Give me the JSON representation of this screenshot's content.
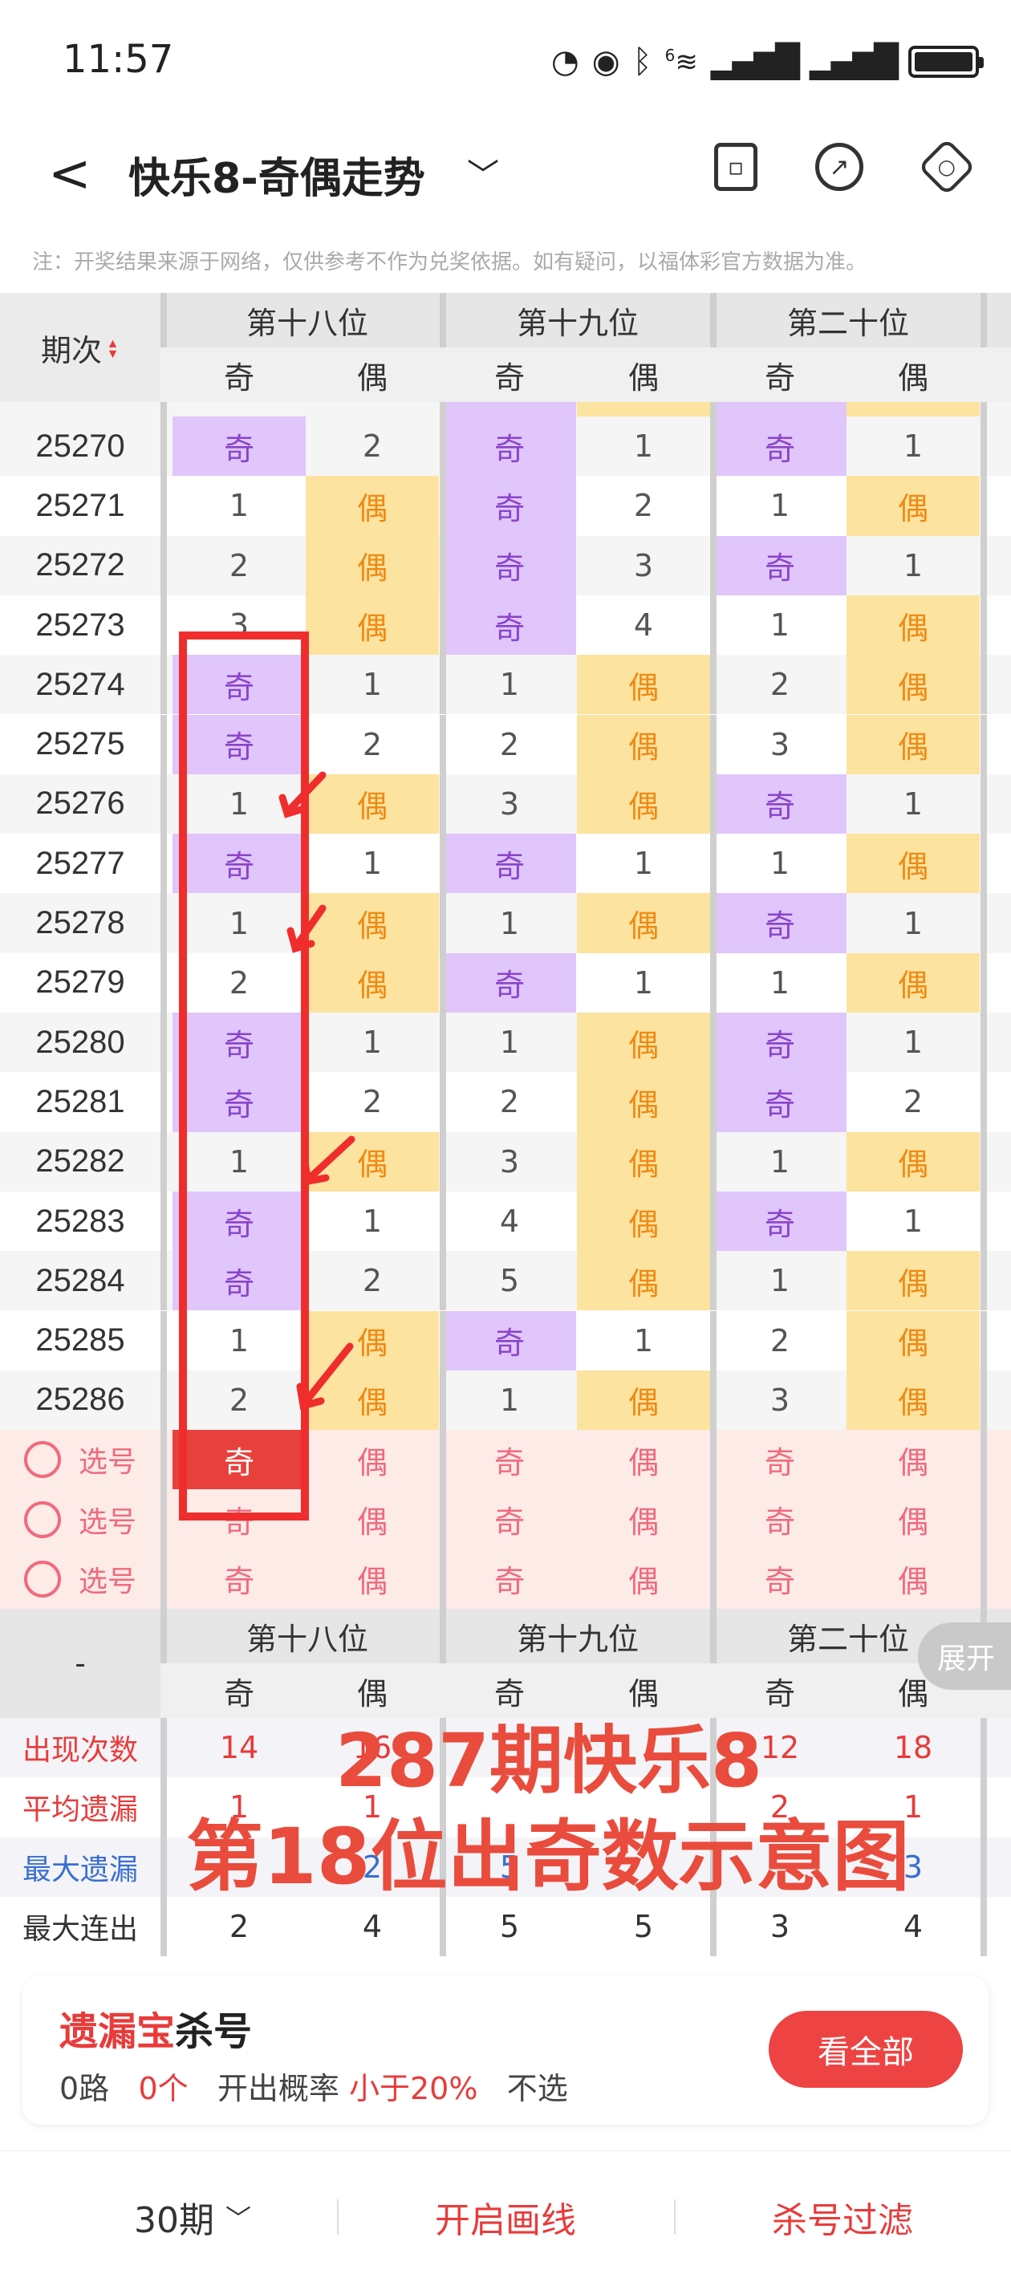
{
  "status": {
    "time": "11:57",
    "net_label": "6"
  },
  "header": {
    "title": "快乐8-奇偶走势",
    "back_glyph": "<",
    "dropdown_glyph": "﹀"
  },
  "notice": "注：开奖结果来源于网络，仅供参考不作为兑奖依据。如有疑问，以福体彩官方数据为准。",
  "table": {
    "issue_header": "期次",
    "sort_glyph": "▲▼",
    "groups": [
      "第十八位",
      "第十九位",
      "第二十位"
    ],
    "sub": [
      "奇",
      "偶"
    ],
    "rows": [
      {
        "issue": "25270",
        "cells": [
          "奇",
          "2",
          "奇",
          "1",
          "奇",
          "1"
        ],
        "hits": [
          "odd",
          "",
          "odd",
          "",
          "odd",
          ""
        ]
      },
      {
        "issue": "25271",
        "cells": [
          "1",
          "偶",
          "奇",
          "2",
          "1",
          "偶"
        ],
        "hits": [
          "",
          "even",
          "odd",
          "",
          "",
          "even"
        ]
      },
      {
        "issue": "25272",
        "cells": [
          "2",
          "偶",
          "奇",
          "3",
          "奇",
          "1"
        ],
        "hits": [
          "",
          "even",
          "odd",
          "",
          "odd",
          ""
        ]
      },
      {
        "issue": "25273",
        "cells": [
          "3",
          "偶",
          "奇",
          "4",
          "1",
          "偶"
        ],
        "hits": [
          "",
          "even",
          "odd",
          "",
          "",
          "even"
        ]
      },
      {
        "issue": "25274",
        "cells": [
          "奇",
          "1",
          "1",
          "偶",
          "2",
          "偶"
        ],
        "hits": [
          "odd",
          "",
          "",
          "even",
          "",
          "even"
        ]
      },
      {
        "issue": "25275",
        "cells": [
          "奇",
          "2",
          "2",
          "偶",
          "3",
          "偶"
        ],
        "hits": [
          "odd",
          "",
          "",
          "even",
          "",
          "even"
        ]
      },
      {
        "issue": "25276",
        "cells": [
          "1",
          "偶",
          "3",
          "偶",
          "奇",
          "1"
        ],
        "hits": [
          "",
          "even",
          "",
          "even",
          "odd",
          ""
        ]
      },
      {
        "issue": "25277",
        "cells": [
          "奇",
          "1",
          "奇",
          "1",
          "1",
          "偶"
        ],
        "hits": [
          "odd",
          "",
          "odd",
          "",
          "",
          "even"
        ]
      },
      {
        "issue": "25278",
        "cells": [
          "1",
          "偶",
          "1",
          "偶",
          "奇",
          "1"
        ],
        "hits": [
          "",
          "even",
          "",
          "even",
          "odd",
          ""
        ]
      },
      {
        "issue": "25279",
        "cells": [
          "2",
          "偶",
          "奇",
          "1",
          "1",
          "偶"
        ],
        "hits": [
          "",
          "even",
          "odd",
          "",
          "",
          "even"
        ]
      },
      {
        "issue": "25280",
        "cells": [
          "奇",
          "1",
          "1",
          "偶",
          "奇",
          "1"
        ],
        "hits": [
          "odd",
          "",
          "",
          "even",
          "odd",
          ""
        ]
      },
      {
        "issue": "25281",
        "cells": [
          "奇",
          "2",
          "2",
          "偶",
          "奇",
          "2"
        ],
        "hits": [
          "odd",
          "",
          "",
          "even",
          "odd",
          ""
        ]
      },
      {
        "issue": "25282",
        "cells": [
          "1",
          "偶",
          "3",
          "偶",
          "1",
          "偶"
        ],
        "hits": [
          "",
          "even",
          "",
          "even",
          "",
          "even"
        ]
      },
      {
        "issue": "25283",
        "cells": [
          "奇",
          "1",
          "4",
          "偶",
          "奇",
          "1"
        ],
        "hits": [
          "odd",
          "",
          "",
          "even",
          "odd",
          ""
        ]
      },
      {
        "issue": "25284",
        "cells": [
          "奇",
          "2",
          "5",
          "偶",
          "1",
          "偶"
        ],
        "hits": [
          "odd",
          "",
          "",
          "even",
          "",
          "even"
        ]
      },
      {
        "issue": "25285",
        "cells": [
          "1",
          "偶",
          "奇",
          "1",
          "2",
          "偶"
        ],
        "hits": [
          "",
          "even",
          "odd",
          "",
          "",
          "even"
        ]
      },
      {
        "issue": "25286",
        "cells": [
          "2",
          "偶",
          "1",
          "偶",
          "3",
          "偶"
        ],
        "hits": [
          "",
          "even",
          "",
          "even",
          "",
          "even"
        ]
      }
    ],
    "pick_label": "选号",
    "pick_cells": [
      "奇",
      "偶",
      "奇",
      "偶",
      "奇",
      "偶"
    ],
    "stats_dash": "-",
    "stats": [
      {
        "label": "出现次数",
        "color": "#e83b3b",
        "values": [
          "14",
          "16",
          "",
          "",
          "12",
          "18"
        ]
      },
      {
        "label": "平均遗漏",
        "color": "#e83b3b",
        "values": [
          "1",
          "1",
          "",
          "",
          "2",
          "1"
        ]
      },
      {
        "label": "最大遗漏",
        "color": "#3a6fd1",
        "values": [
          "",
          "2",
          "5",
          "",
          "",
          "3"
        ]
      },
      {
        "label": "最大连出",
        "color": "#333333",
        "values": [
          "2",
          "4",
          "5",
          "5",
          "3",
          "4"
        ]
      }
    ]
  },
  "expand_label": "展开",
  "annotation": {
    "line1": "287期快乐8",
    "line2": "第18位出奇数示意图"
  },
  "card": {
    "title_red": "遗漏宝",
    "title_rest": "杀号",
    "info_route": "0路",
    "info_count": "0个",
    "info_prob_label": "开出概率",
    "info_prob_value": "小于20%",
    "info_tail": "不选",
    "button": "看全部"
  },
  "footer": {
    "period": "30期",
    "period_glyph": "﹀",
    "draw_line": "开启画线",
    "filter": "杀号过滤"
  },
  "colors": {
    "odd_bg": "#e0c6fb",
    "even_bg": "#fde3a0",
    "accent": "#e83b3b"
  }
}
